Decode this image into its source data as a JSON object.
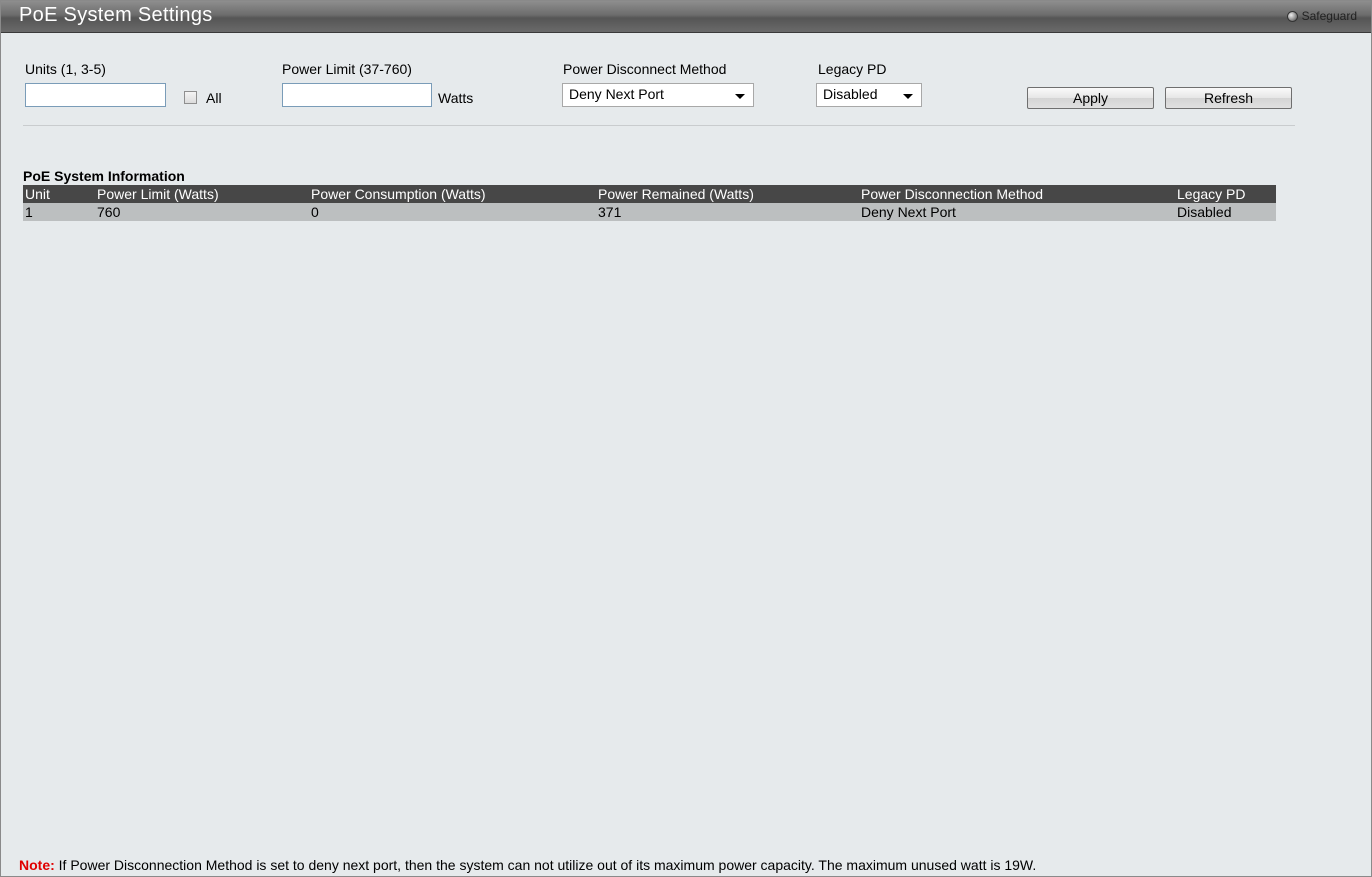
{
  "header": {
    "title": "PoE System Settings",
    "safeguard_label": "Safeguard"
  },
  "form": {
    "units_label": "Units (1, 3-5)",
    "units_value": "",
    "all_label": "All",
    "power_limit_label": "Power Limit  (37-760)",
    "power_limit_value": "",
    "watts_label": "Watts",
    "disconnect_label": "Power Disconnect Method",
    "disconnect_value": "Deny Next Port",
    "legacy_label": "Legacy PD",
    "legacy_value": "Disabled",
    "apply_label": "Apply",
    "refresh_label": "Refresh"
  },
  "info": {
    "title": "PoE System Information",
    "columns": [
      "Unit",
      "Power Limit (Watts)",
      "Power Consumption (Watts)",
      "Power Remained (Watts)",
      "Power Disconnection Method",
      "Legacy PD"
    ],
    "rows": [
      [
        "1",
        "760",
        "0",
        "371",
        "Deny Next Port",
        "Disabled"
      ]
    ]
  },
  "note": {
    "label": "Note:",
    "text": " If Power Disconnection Method is set to deny next port, then the system can not utilize out of its maximum power capacity. The maximum unused watt is 19W."
  }
}
